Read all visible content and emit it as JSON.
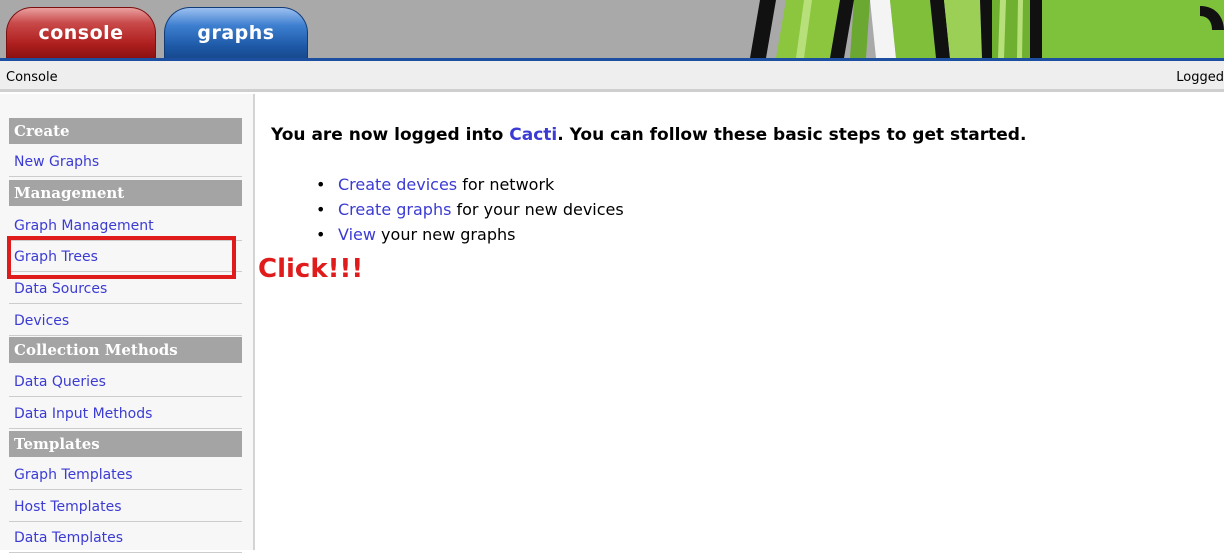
{
  "tabs": {
    "console": "console",
    "graphs": "graphs"
  },
  "breadcrumb": {
    "label": "Console",
    "login_status": "Logged"
  },
  "sidebar": {
    "sections": [
      {
        "header": "Create",
        "items": [
          "New Graphs"
        ]
      },
      {
        "header": "Management",
        "items": [
          "Graph Management",
          "Graph Trees",
          "Data Sources",
          "Devices"
        ]
      },
      {
        "header": "Collection Methods",
        "items": [
          "Data Queries",
          "Data Input Methods"
        ]
      },
      {
        "header": "Templates",
        "items": [
          "Graph Templates",
          "Host Templates",
          "Data Templates"
        ]
      }
    ]
  },
  "annotation": {
    "text": "Click!!!",
    "color": "#e01b1b"
  },
  "main": {
    "welcome_prefix": "You are now logged into ",
    "welcome_link": "Cacti",
    "welcome_suffix": ". You can follow these basic steps to get started.",
    "steps": [
      {
        "link": "Create devices",
        "text": " for network"
      },
      {
        "link": "Create graphs",
        "text": " for your new devices"
      },
      {
        "link": "View",
        "text": " your new graphs"
      }
    ]
  },
  "colors": {
    "link": "#3b3bd4",
    "header_bg": "#a4a4a4",
    "console_tab": "#b02020",
    "graphs_tab": "#1e5aa8"
  }
}
